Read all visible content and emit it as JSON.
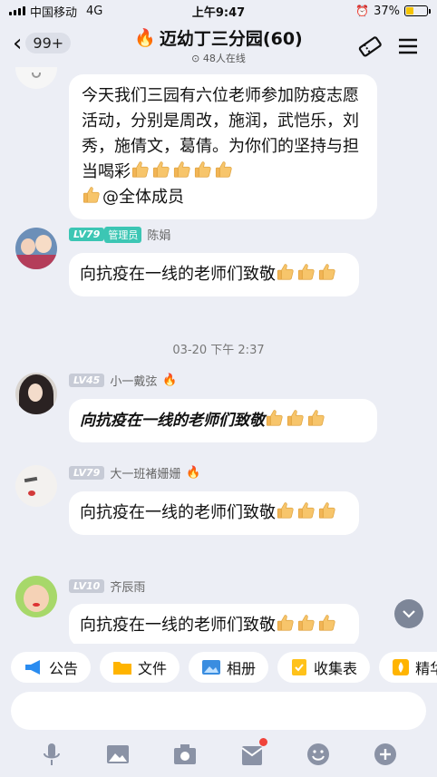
{
  "status": {
    "carrier": "中国移动",
    "network": "4G",
    "time": "上午9:47",
    "battery": "37%",
    "battery_level": 0.37
  },
  "header": {
    "back_badge": "99+",
    "group_name": "迈幼丁三分园(60)",
    "online": "48人在线"
  },
  "messages": [
    {
      "text": "今天我们三园有六位老师参加防疫志愿活动，分别是周改，施润，武恺乐，刘秀，施倩文，葛倩。为你们的坚持与担当喝彩",
      "thumbs_inline": 5,
      "line2": "@全体成员",
      "thumbs_line2": 1
    },
    {
      "level": "LV79",
      "role": "管理员",
      "sender": "陈娟",
      "text": "向抗疫在一线的老师们致敬",
      "thumbs": 3
    },
    {
      "level": "LV45",
      "sender": "小一戴弦",
      "text": "向抗疫在一线的老师们致敬",
      "thumbs": 3
    },
    {
      "level": "LV79",
      "sender": "大一班褚姗姗",
      "text": "向抗疫在一线的老师们致敬",
      "thumbs": 3
    },
    {
      "level": "LV10",
      "sender": "齐辰雨",
      "text": "向抗疫在一线的老师们致敬",
      "thumbs": 3
    }
  ],
  "timestamp": "03-20 下午 2:37",
  "toolbar": {
    "announce": "公告",
    "files": "文件",
    "album": "相册",
    "form": "收集表",
    "featured": "精华"
  },
  "colors": {
    "accent": "#3cc6b4",
    "bubble": "#ffffff",
    "background": "#eceef5",
    "flame": "#ff5a1f",
    "thumb": "#f7c56b"
  }
}
